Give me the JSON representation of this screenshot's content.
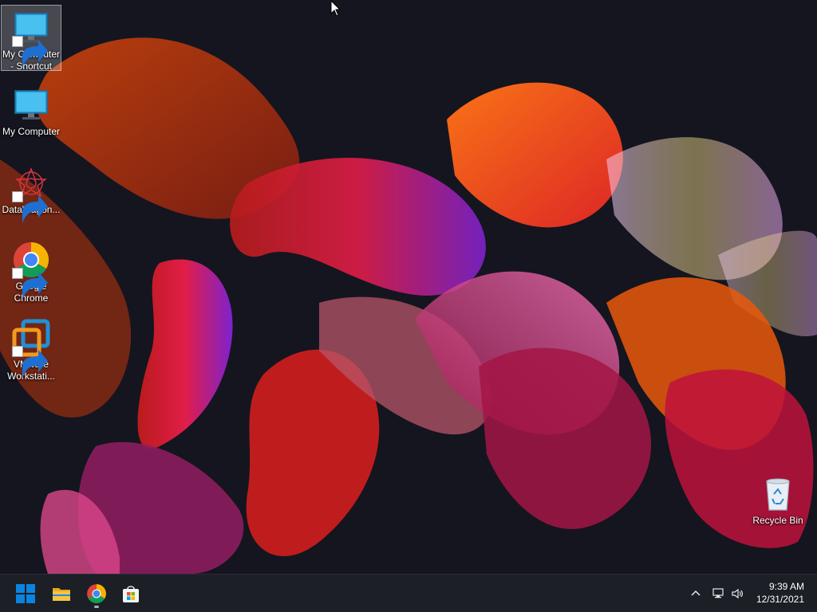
{
  "desktop": {
    "icons": [
      {
        "name": "My Computer\n- Shortcut",
        "label": "My Computer - Shortcut",
        "line1": "My Computer",
        "line2": "- Shortcut",
        "icon": "monitor-icon",
        "shortcut": true,
        "selected": true
      },
      {
        "line1": "My Computer",
        "line2": "",
        "icon": "monitor-icon",
        "shortcut": false
      },
      {
        "line1": "DataWagon...",
        "line2": "",
        "icon": "datawagon-icon",
        "shortcut": true
      },
      {
        "line1": "Google",
        "line2": "Chrome",
        "icon": "chrome-icon",
        "shortcut": true
      },
      {
        "line1": "VMware",
        "line2": "Workstati...",
        "icon": "vmware-icon",
        "shortcut": true
      },
      {
        "line1": "Recycle Bin",
        "line2": "",
        "icon": "recycle-bin-icon",
        "shortcut": false
      }
    ]
  },
  "taskbar": {
    "pinned": [
      {
        "name": "start-button",
        "icon": "windows-logo-icon"
      },
      {
        "name": "file-explorer-button",
        "icon": "folder-icon"
      },
      {
        "name": "chrome-button",
        "icon": "chrome-icon",
        "running": true
      },
      {
        "name": "microsoft-store-button",
        "icon": "store-icon"
      }
    ],
    "tray": {
      "chevron": "chevron-up-icon",
      "network": "network-icon",
      "volume": "speaker-icon"
    },
    "clock": {
      "time": "9:39 AM",
      "date": "12/31/2021"
    }
  },
  "colors": {
    "taskbar_bg": "#1c1f26",
    "desktop_bg": "#14151f",
    "windows_blue": "#0078d4",
    "folder_yellow": "#f4c542"
  }
}
